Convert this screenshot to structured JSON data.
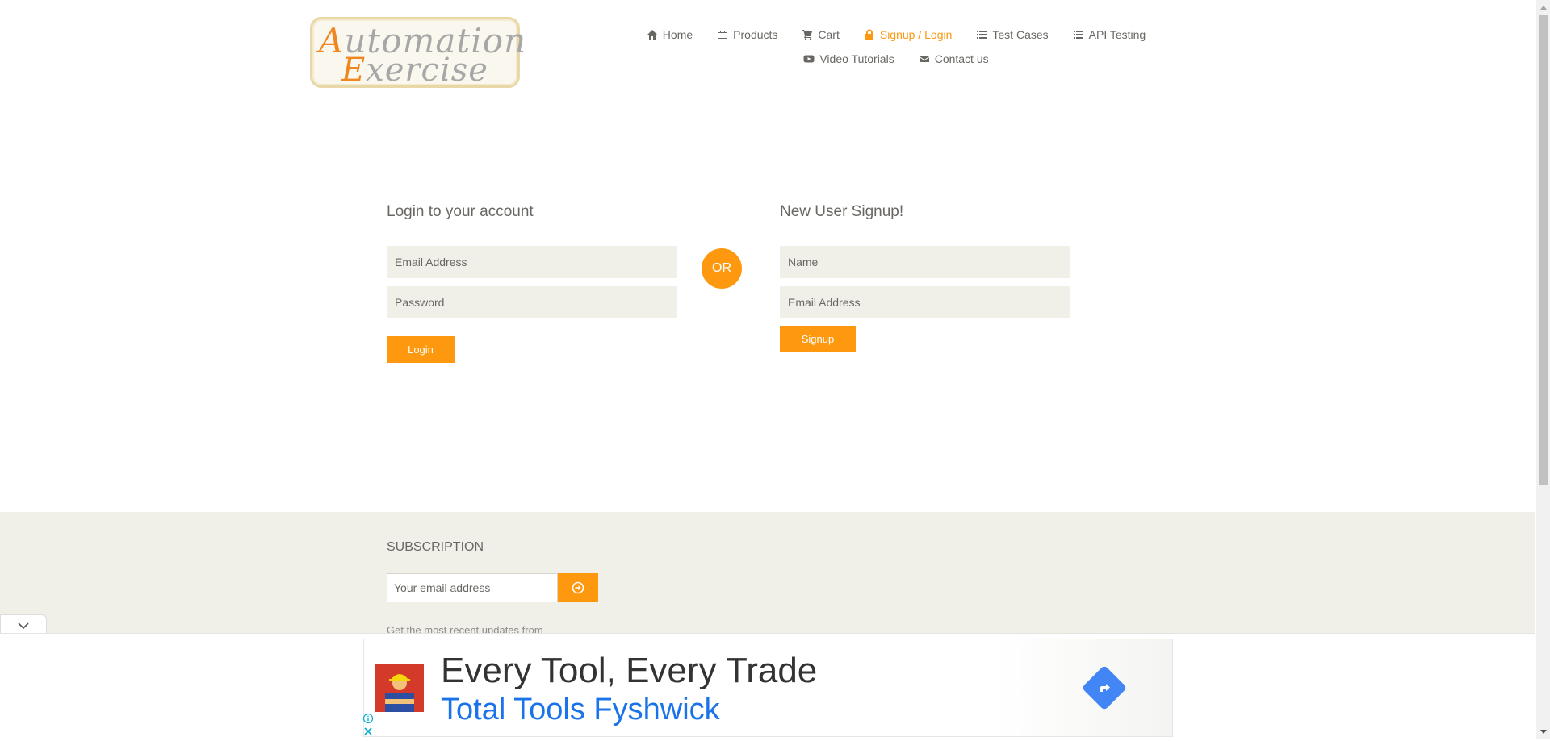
{
  "logo": {
    "line1_cap": "A",
    "line1_rest": "utomation",
    "line2_cap": "E",
    "line2_rest": "xercise"
  },
  "nav": {
    "items": [
      {
        "label": "Home",
        "icon": "home-icon"
      },
      {
        "label": "Products",
        "icon": "products-icon"
      },
      {
        "label": "Cart",
        "icon": "cart-icon"
      },
      {
        "label": "Signup / Login",
        "icon": "lock-icon",
        "active": true
      },
      {
        "label": "Test Cases",
        "icon": "list-icon"
      },
      {
        "label": "API Testing",
        "icon": "list-icon"
      },
      {
        "label": "Video Tutorials",
        "icon": "youtube-play-icon"
      },
      {
        "label": "Contact us",
        "icon": "envelope-icon"
      }
    ]
  },
  "login": {
    "title": "Login to your account",
    "email_placeholder": "Email Address",
    "password_placeholder": "Password",
    "button": "Login"
  },
  "or_label": "OR",
  "signup": {
    "title": "New User Signup!",
    "name_placeholder": "Name",
    "email_placeholder": "Email Address",
    "button": "Signup"
  },
  "footer": {
    "subscription_title": "SUBSCRIPTION",
    "email_placeholder": "Your email address",
    "note": "Get the most recent updates from"
  },
  "ad": {
    "headline": "Every Tool, Every Trade",
    "subline": "Total Tools Fyshwick"
  },
  "colors": {
    "accent": "#FE980F",
    "text": "#696763",
    "input_bg": "#F0F0E9",
    "ad_link": "#1a73e8"
  }
}
